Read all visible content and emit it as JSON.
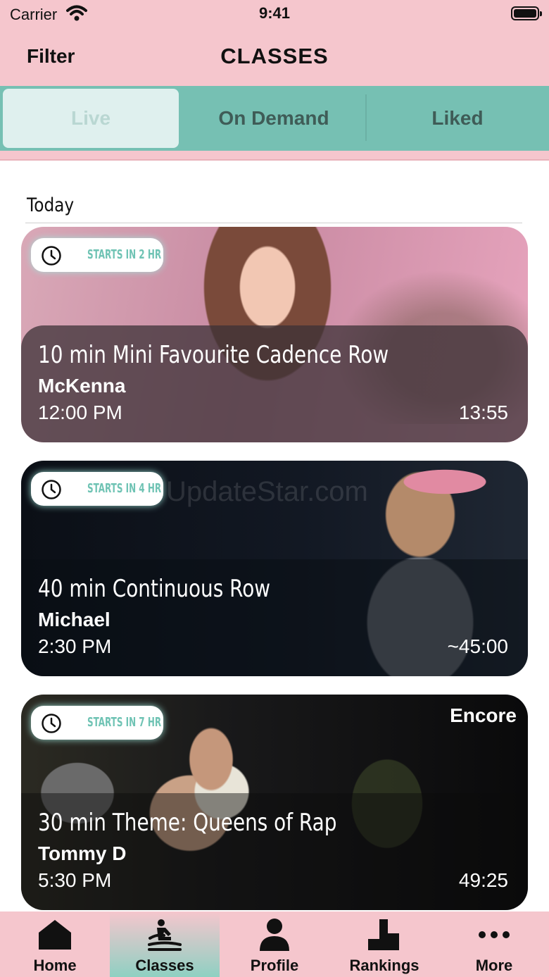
{
  "status_bar": {
    "carrier": "Carrier",
    "time": "9:41"
  },
  "nav": {
    "filter_label": "Filter",
    "title": "CLASSES"
  },
  "segments": [
    {
      "label": "Live",
      "selected": true
    },
    {
      "label": "On Demand",
      "selected": false
    },
    {
      "label": "Liked",
      "selected": false
    }
  ],
  "section_header": "Today",
  "classes": [
    {
      "badge": "STARTS IN 2 HR",
      "title": "10 min Mini Favourite Cadence Row",
      "instructor": "McKenna",
      "start_time": "12:00 PM",
      "duration": "13:55",
      "tag": ""
    },
    {
      "badge": "STARTS IN 4 HR",
      "title": "40 min Continuous Row",
      "instructor": "Michael",
      "start_time": "2:30 PM",
      "duration": "~45:00",
      "tag": ""
    },
    {
      "badge": "STARTS IN 7 HR",
      "title": "30 min Theme: Queens of Rap",
      "instructor": "Tommy D",
      "start_time": "5:30 PM",
      "duration": "49:25",
      "tag": "Encore"
    }
  ],
  "watermark": "UpdateStar.com",
  "tab_bar": [
    {
      "label": "Home",
      "icon": "home-icon",
      "active": false
    },
    {
      "label": "Classes",
      "icon": "rower-icon",
      "active": true
    },
    {
      "label": "Profile",
      "icon": "person-icon",
      "active": false
    },
    {
      "label": "Rankings",
      "icon": "podium-icon",
      "active": false
    },
    {
      "label": "More",
      "icon": "ellipsis-icon",
      "active": false
    }
  ],
  "colors": {
    "header_pink": "#f5c6cd",
    "teal": "#76c0b3",
    "badge_text": "#6fc3b4"
  }
}
